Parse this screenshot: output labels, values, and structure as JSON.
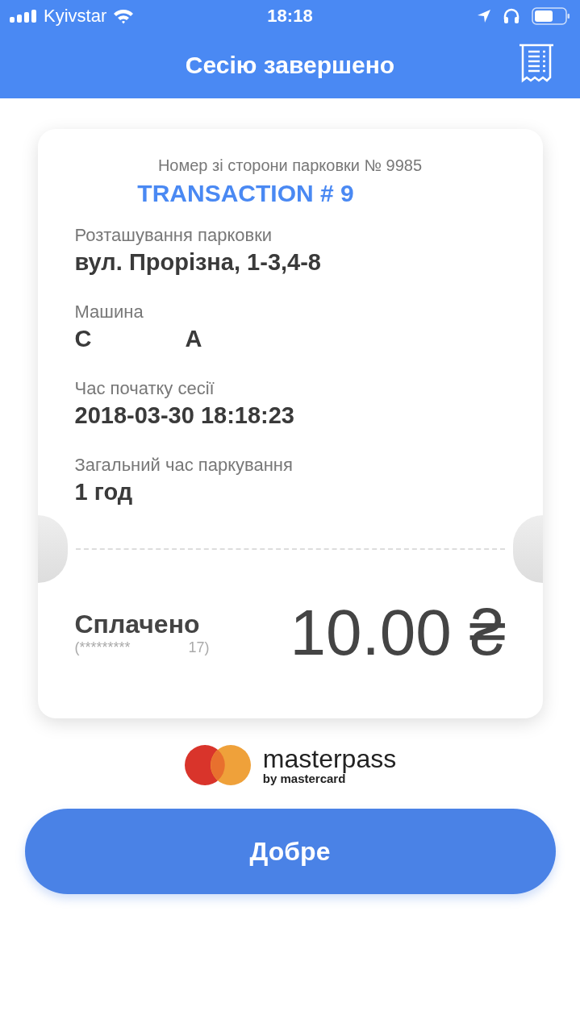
{
  "status_bar": {
    "carrier": "Kyivstar",
    "time": "18:18"
  },
  "header": {
    "title": "Сесію завершено"
  },
  "receipt": {
    "parking_number": "Номер зі сторони парковки № 9985",
    "transaction": "TRANSACTION # 9",
    "fields": [
      {
        "label": "Розташування парковки",
        "parts": [
          "вул. Прорізна, 1-3,4-8"
        ]
      },
      {
        "label": "Машина",
        "parts": [
          "C",
          "A"
        ]
      },
      {
        "label": "Час початку сесії",
        "parts": [
          "2018-03-30 18:18:23"
        ]
      },
      {
        "label": "Загальний час паркування",
        "parts": [
          "1 год"
        ]
      }
    ],
    "payment": {
      "label": "Сплачено",
      "card_parts": [
        "(*********",
        "17)"
      ],
      "amount": "10.00 ₴"
    }
  },
  "brand": {
    "name": "masterpass",
    "tagline": "by mastercard"
  },
  "button": {
    "label": "Добре"
  }
}
